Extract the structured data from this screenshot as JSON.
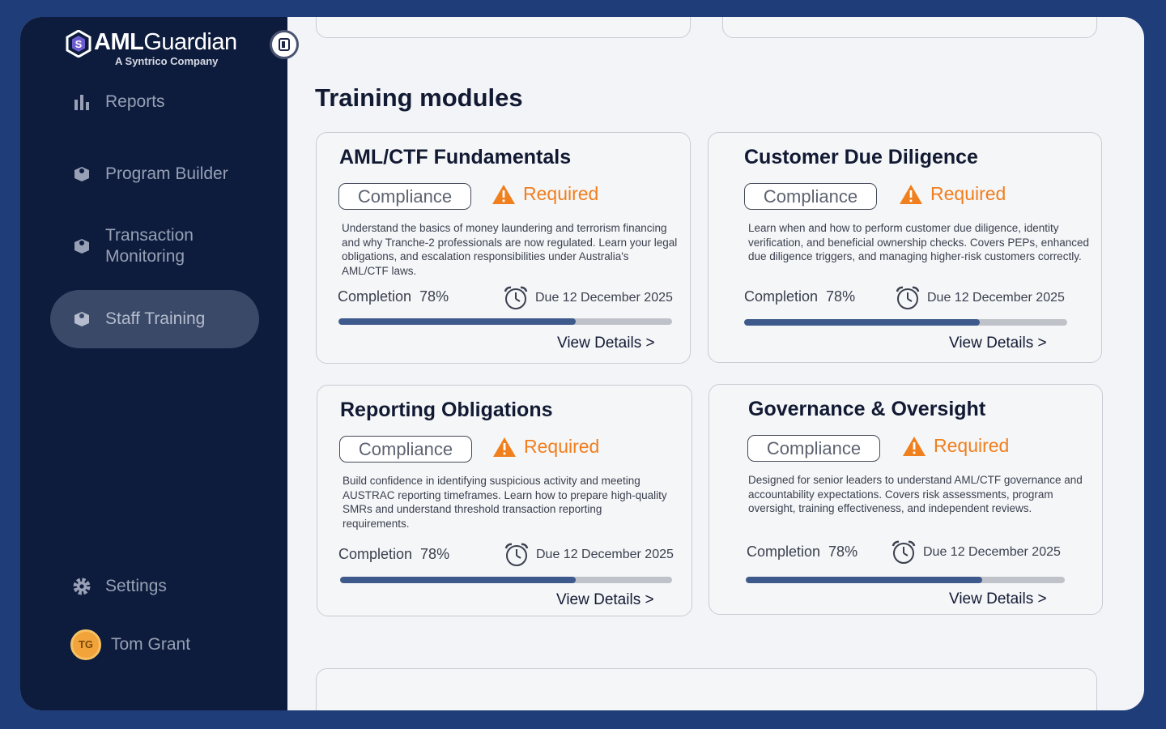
{
  "brand": {
    "name_bold": "AML",
    "name_light": "Guardian",
    "tagline": "A Syntrico Company"
  },
  "sidebar": {
    "items": [
      {
        "label": "Reports",
        "icon": "bar-chart-icon"
      },
      {
        "label": "Program Builder",
        "icon": "module-icon"
      },
      {
        "label": "Transaction Monitoring",
        "icon": "module-icon"
      },
      {
        "label": "Staff Training",
        "icon": "module-icon",
        "active": true
      }
    ],
    "settings_label": "Settings",
    "user": {
      "initials": "TG",
      "name": "Tom Grant"
    }
  },
  "main": {
    "section_title": "Training modules",
    "cards": [
      {
        "title": "AML/CTF Fundamentals",
        "tag": "Compliance",
        "status": "Required",
        "description": "Understand the basics of money laundering and terrorism financing and why Tranche-2 professionals are now regulated. Learn your legal obligations, and escalation responsibilities under Australia's AML/CTF laws.",
        "completion_label": "Completion",
        "completion_value": "78%",
        "completion_fraction": 0.71,
        "due": "Due 12 December 2025",
        "link": "View Details >"
      },
      {
        "title": "Customer Due Diligence",
        "tag": "Compliance",
        "status": "Required",
        "description": "Learn when and how to perform customer due diligence, identity verification, and beneficial ownership checks. Covers PEPs, enhanced due diligence triggers, and managing higher-risk customers correctly.",
        "completion_label": "Completion",
        "completion_value": "78%",
        "completion_fraction": 0.73,
        "due": "Due 12 December 2025",
        "link": "View Details >"
      },
      {
        "title": "Reporting Obligations",
        "tag": "Compliance",
        "status": "Required",
        "description": "Build confidence in identifying suspicious activity and meeting AUSTRAC reporting timeframes. Learn how to prepare high-quality SMRs and understand threshold transaction reporting requirements.",
        "completion_label": "Completion",
        "completion_value": "78%",
        "completion_fraction": 0.71,
        "due": "Due 12 December 2025",
        "link": "View Details >"
      },
      {
        "title": "Governance & Oversight",
        "tag": "Compliance",
        "status": "Required",
        "description": "Designed for senior leaders to understand AML/CTF governance and accountability expectations. Covers risk assessments, program oversight, training effectiveness, and independent reviews.",
        "completion_label": "Completion",
        "completion_value": "78%",
        "completion_fraction": 0.74,
        "due": "Due 12 December 2025",
        "link": "View Details >"
      }
    ]
  },
  "colors": {
    "sidebar_bg": "#0d1b3d",
    "accent_orange": "#f07f1e",
    "progress_fill": "#3e5a8c",
    "avatar": "#f2a33a"
  }
}
